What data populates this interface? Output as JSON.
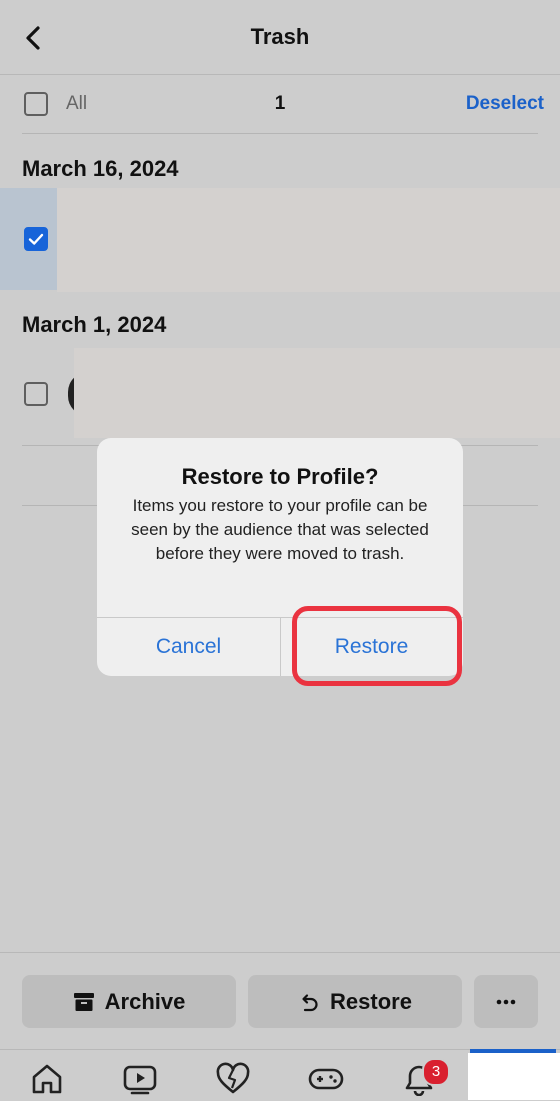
{
  "header": {
    "title": "Trash",
    "back_icon": "chevron-left-icon"
  },
  "selection": {
    "all_label": "All",
    "count": "1",
    "deselect_label": "Deselect",
    "all_checked": false
  },
  "groups": [
    {
      "date": "March 16, 2024",
      "items": [
        {
          "checked": true
        }
      ]
    },
    {
      "date": "March 1, 2024",
      "items": [
        {
          "checked": false
        }
      ]
    }
  ],
  "dialog": {
    "title": "Restore to Profile?",
    "message": "Items you restore to your profile can be seen by the audience that was selected before they were moved to trash.",
    "cancel_label": "Cancel",
    "confirm_label": "Restore"
  },
  "actions": {
    "archive_label": "Archive",
    "archive_icon": "archive-box-icon",
    "restore_label": "Restore",
    "restore_icon": "undo-arrow-icon",
    "more_icon": "more-horizontal-icon"
  },
  "tabbar": {
    "tabs": [
      "home-icon",
      "video-icon",
      "heart-icon",
      "gaming-icon",
      "notifications-bell-icon"
    ],
    "notification_badge": "3"
  },
  "colors": {
    "accent": "#1b61c9",
    "dialog_button": "#2a73d6",
    "highlight": "#ea3340",
    "badge": "#d9202f"
  }
}
